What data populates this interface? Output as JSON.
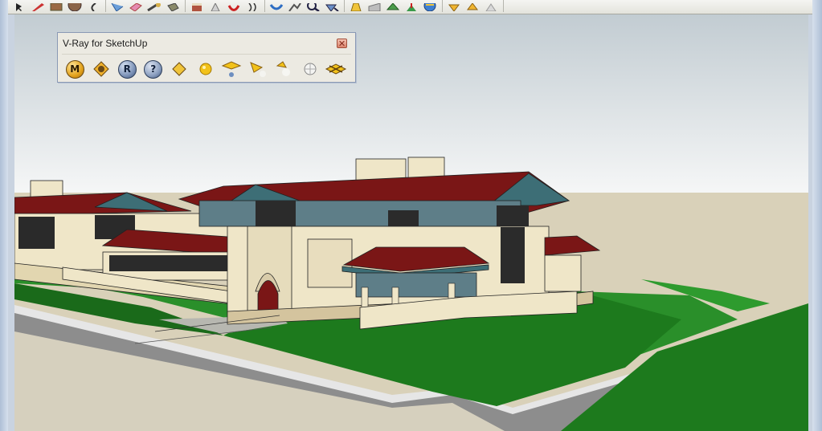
{
  "window": {
    "accent_frame": "#c9d3e0"
  },
  "toolbar": {
    "icons": [
      "select-arrow-icon",
      "pencil-icon",
      "rectangle-icon",
      "circle-icon",
      "arc-icon",
      "make-component-icon",
      "eraser-icon",
      "tape-measure-icon",
      "paint-bucket-icon",
      "push-pull-icon",
      "move-icon",
      "rotate-icon",
      "follow-me-icon",
      "orbit-icon",
      "pan-icon",
      "zoom-icon",
      "zoom-extents-icon",
      "previous-view-icon",
      "next-view-icon",
      "standard-views-icon",
      "section-plane-icon",
      "get-models-icon",
      "import-icon",
      "export-icon",
      "warehouse-icon"
    ]
  },
  "vray_palette": {
    "title": "V-Ray for SketchUp",
    "tools": [
      {
        "name": "material-editor-tool",
        "label": "M"
      },
      {
        "name": "options-tool",
        "label": ""
      },
      {
        "name": "render-tool",
        "label": "R"
      },
      {
        "name": "help-tool",
        "label": "?"
      },
      {
        "name": "frame-buffer-tool",
        "label": ""
      },
      {
        "name": "sphere-light-tool",
        "label": ""
      },
      {
        "name": "rectangle-light-tool",
        "label": ""
      },
      {
        "name": "spot-light-tool",
        "label": ""
      },
      {
        "name": "ies-light-tool",
        "label": ""
      },
      {
        "name": "omni-light-tool",
        "label": ""
      },
      {
        "name": "infinite-plane-tool",
        "label": ""
      }
    ]
  },
  "scene": {
    "sky_top": "#c3cdd3",
    "sky_bottom": "#f5f6f6",
    "ground": "#d8d0b8",
    "lawn_dark": "#1f7a1f",
    "lawn_light": "#2e9a2e",
    "road": "#8c8c8c",
    "roof": "#7a1616",
    "trim": "#3d6e76",
    "wall": "#efe6c8"
  }
}
